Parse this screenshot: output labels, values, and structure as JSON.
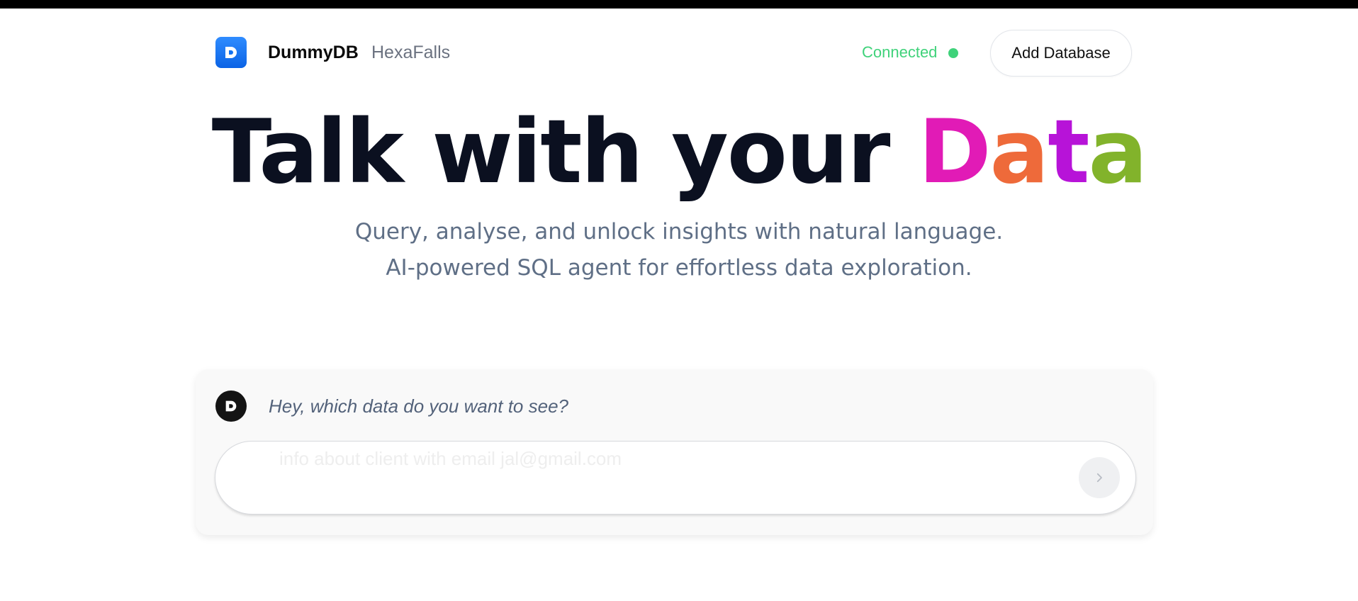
{
  "header": {
    "brand_name": "DummyDB",
    "org_name": "HexaFalls",
    "status_label": "Connected",
    "add_database_label": "Add Database"
  },
  "hero": {
    "title_main": "Talk with your ",
    "title_accent_letters": [
      "D",
      "a",
      "t",
      "a"
    ],
    "title_accent_colors": [
      "#e11bb6",
      "#ee6a3a",
      "#b713d8",
      "#82b32b"
    ],
    "subtitle_line1": "Query, analyse, and unlock insights with natural language.",
    "subtitle_line2": "AI-powered SQL agent for effortless data exploration."
  },
  "chat": {
    "bot_prompt": "Hey, which data do you want to see?",
    "input_placeholder": "info about client with email jal@gmail.com",
    "input_value": ""
  },
  "colors": {
    "brand_blue": "#1472f0",
    "status_green": "#3fd27a",
    "title_dark": "#0b1020",
    "subtitle_gray": "#5f6f86"
  },
  "icons": {
    "logo": "dummydb-logo-icon",
    "avatar": "dummydb-bot-avatar-icon",
    "send": "chevron-right-icon"
  }
}
